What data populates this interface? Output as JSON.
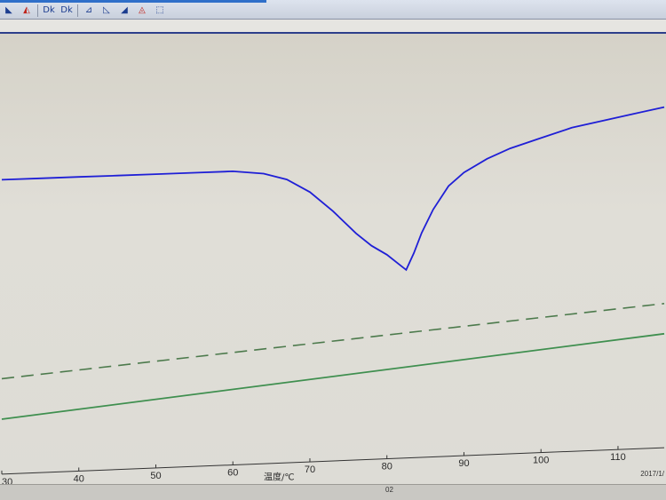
{
  "toolbar": {
    "buttons": [
      {
        "glyph": "◣",
        "color": "blue"
      },
      {
        "glyph": "◭",
        "color": "red"
      },
      {
        "glyph": "Dk",
        "color": "blue"
      },
      {
        "glyph": "Dk",
        "color": "blue"
      },
      {
        "glyph": "⊿",
        "color": "blue"
      },
      {
        "glyph": "◺",
        "color": "blue"
      },
      {
        "glyph": "◢",
        "color": "blue"
      },
      {
        "glyph": "◬",
        "color": "red"
      },
      {
        "glyph": "⬚",
        "color": "blue"
      }
    ]
  },
  "chart_data": {
    "type": "line",
    "xlabel": "温度/℃",
    "x_ticks": [
      30,
      40,
      50,
      60,
      70,
      80,
      90,
      100,
      110
    ],
    "xlim": [
      30,
      116
    ],
    "grid": false,
    "series": [
      {
        "style": "solid",
        "color": "#1f1fd6",
        "x": [
          30,
          35,
          40,
          45,
          50,
          55,
          60,
          64,
          67,
          70,
          73,
          76,
          78,
          80,
          81.5,
          82.5,
          83.5,
          84.5,
          86,
          88,
          90,
          93,
          96,
          100,
          104,
          108,
          112,
          116
        ],
        "y": [
          0.7,
          0.7,
          0.7,
          0.7,
          0.7,
          0.7,
          0.7,
          0.69,
          0.67,
          0.63,
          0.57,
          0.5,
          0.46,
          0.43,
          0.4,
          0.38,
          0.43,
          0.49,
          0.56,
          0.63,
          0.67,
          0.71,
          0.74,
          0.77,
          0.8,
          0.82,
          0.84,
          0.86
        ]
      },
      {
        "style": "dashed",
        "color": "#4c7a4c",
        "x": [
          30,
          116
        ],
        "y": [
          0.16,
          0.21
        ]
      },
      {
        "style": "solid",
        "color": "#3f8f4f",
        "x": [
          30,
          116
        ],
        "y": [
          0.05,
          0.11
        ]
      }
    ]
  },
  "status": {
    "center_text": "02",
    "date_text": "2017/1/"
  }
}
